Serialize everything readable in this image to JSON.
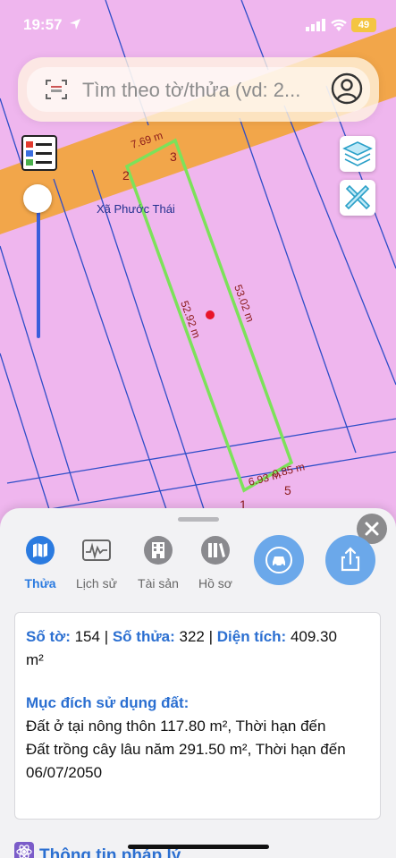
{
  "status_bar": {
    "time": "19:57",
    "battery": "49"
  },
  "search": {
    "placeholder": "Tìm theo tờ/thửa (vd: 2..."
  },
  "map": {
    "commune_label": "Xã Phước Thái",
    "vertex_labels": [
      "2",
      "3",
      "1",
      "5"
    ],
    "edge_labels": [
      "7.69 m",
      "53.02 m",
      "52.92 m",
      "6.93 m",
      "0.85 m"
    ],
    "colors": {
      "land": "#efb6ee",
      "road": "#f2a64a",
      "parcel_outline": "#7ce25a",
      "grid_lines": "#2f4ec8"
    }
  },
  "tabs": [
    {
      "label": "Thửa",
      "icon": "map-icon",
      "active": true
    },
    {
      "label": "Lịch sử",
      "icon": "history-icon",
      "active": false
    },
    {
      "label": "Tài sản",
      "icon": "building-icon",
      "active": false
    },
    {
      "label": "Hồ sơ",
      "icon": "library-icon",
      "active": false
    }
  ],
  "action_buttons": [
    {
      "icon": "car-icon"
    },
    {
      "icon": "share-icon"
    }
  ],
  "parcel": {
    "sheet_label": "Số tờ:",
    "sheet_value": "154",
    "parcel_label": "Số thửa:",
    "parcel_value": "322",
    "area_label": "Diện tích:",
    "area_value": "409.30",
    "area_unit": "m²",
    "purpose_title": "Mục đích sử dụng đất:",
    "purpose_line_1": "Đất ở tại nông thôn 117.80 m², Thời hạn đến",
    "purpose_line_2": "Đất trồng cây lâu năm 291.50 m², Thời hạn đến",
    "purpose_line_3": "06/07/2050"
  },
  "legal_info_label": "Thông tin pháp lý"
}
